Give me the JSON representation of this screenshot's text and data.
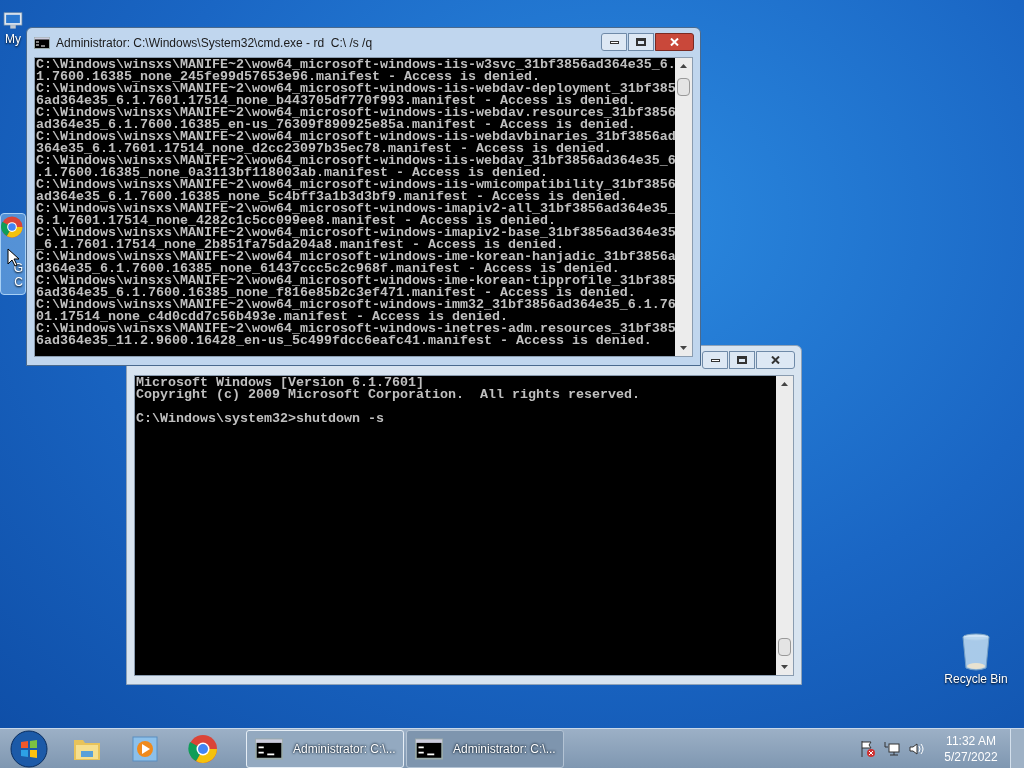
{
  "desktop": {
    "icons": [
      {
        "kind": "computer",
        "label_lines": [
          "My"
        ],
        "selected": false
      },
      {
        "kind": "browser",
        "label_lines": [
          "G",
          "C"
        ],
        "selected": true
      },
      {
        "kind": "recycle-bin",
        "label_lines": [
          "Recycle Bin"
        ],
        "selected": false
      }
    ]
  },
  "windows": [
    {
      "active": true,
      "title": "Administrator: C:\\Windows\\System32\\cmd.exe - rd  C:\\ /s /q",
      "blocks": [
        [
          "C:\\Windows\\winsxs\\MANIFE~2\\wow64_microsoft-windows-iis-w3svc_31bf3856ad364e35_6.",
          "1.7600.16385_none_245fe99d57653e96.manifest - Access is denied.",
          "C:\\Windows\\winsxs\\MANIFE~2\\wow64_microsoft-windows-iis-webdav-deployment_31bf385",
          "6ad364e35_6.1.7601.17514_none_b443705df770f993.manifest - Access is denied.",
          "C:\\Windows\\winsxs\\MANIFE~2\\wow64_microsoft-windows-iis-webdav.resources_31bf3856",
          "ad364e35_6.1.7600.16385_en-us_76309f890925e85a.manifest - Access is denied.",
          "C:\\Windows\\winsxs\\MANIFE~2\\wow64_microsoft-windows-iis-webdavbinaries_31bf3856ad",
          "364e35_6.1.7601.17514_none_d2cc23097b35ec78.manifest - Access is denied.",
          "C:\\Windows\\winsxs\\MANIFE~2\\wow64_microsoft-windows-iis-webdav_31bf3856ad364e35_6",
          ".1.7600.16385_none_0a3113bf118003ab.manifest - Access is denied.",
          "C:\\Windows\\winsxs\\MANIFE~2\\wow64_microsoft-windows-iis-wmicompatibility_31bf3856",
          "ad364e35_6.1.7600.16385_none_5c4bff3a1b3d3bf9.manifest - Access is denied.",
          "C:\\Windows\\winsxs\\MANIFE~2\\wow64_microsoft-windows-imapiv2-all_31bf3856ad364e35_",
          "6.1.7601.17514_none_4282c1c5cc099ee8.manifest - Access is denied.",
          "C:\\Windows\\winsxs\\MANIFE~2\\wow64_microsoft-windows-imapiv2-base_31bf3856ad364e35",
          "_6.1.7601.17514_none_2b851fa75da204a8.manifest - Access is denied.",
          "C:\\Windows\\winsxs\\MANIFE~2\\wow64_microsoft-windows-ime-korean-hanjadic_31bf3856a",
          "d364e35_6.1.7600.16385_none_61437ccc5c2c968f.manifest - Access is denied.",
          "C:\\Windows\\winsxs\\MANIFE~2\\wow64_microsoft-windows-ime-korean-tipprofile_31bf385",
          "6ad364e35_6.1.7600.16385_none_f816e85b2c3ef471.manifest - Access is denied.",
          "C:\\Windows\\winsxs\\MANIFE~2\\wow64_microsoft-windows-imm32_31bf3856ad364e35_6.1.76",
          "01.17514_none_c4d0cdd7c56b493e.manifest - Access is denied.",
          "C:\\Windows\\winsxs\\MANIFE~2\\wow64_microsoft-windows-inetres-adm.resources_31bf385",
          "6ad364e35_11.2.9600.16428_en-us_5c499fdcc6eafc41.manifest - Access is denied."
        ]
      ]
    },
    {
      "active": false,
      "blocks": [
        [
          "Microsoft Windows [Version 6.1.7601]",
          "Copyright (c) 2009 Microsoft Corporation.  All rights reserved."
        ],
        [
          "C:\\Windows\\system32>shutdown -s"
        ]
      ]
    }
  ],
  "taskbar": {
    "pinned": [
      {
        "kind": "explorer"
      },
      {
        "kind": "media-player"
      },
      {
        "kind": "browser"
      }
    ],
    "tasks": [
      {
        "label": "Administrator: C:\\...",
        "selected": true
      },
      {
        "label": "Administrator: C:\\...",
        "selected": false
      }
    ],
    "tray": {
      "time": "11:32 AM",
      "date": "5/27/2022"
    }
  }
}
